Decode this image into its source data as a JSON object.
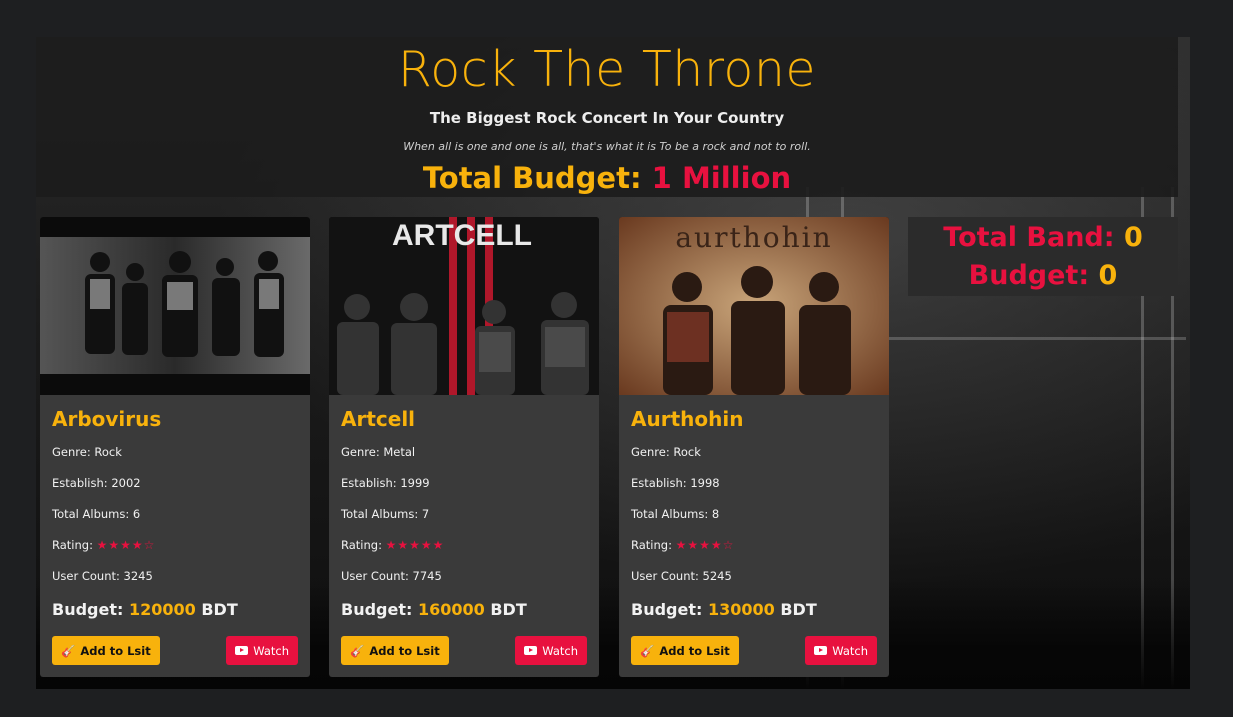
{
  "header": {
    "title": "Rock The Throne",
    "subtitle": "The Biggest Rock Concert In Your Country",
    "tagline": "When all is one and one is all, that's what it is To be a rock and not to roll.",
    "total_budget_label": "Total Budget:",
    "total_budget_value": "1 Million"
  },
  "summary": {
    "total_band_label": "Total Band:",
    "total_band_value": "0",
    "budget_label": "Budget:",
    "budget_value": "0"
  },
  "colors": {
    "accent": "#f8b20c",
    "danger": "#e8113f",
    "card": "#3a3a3a",
    "page": "#1e1f21"
  },
  "cards": [
    {
      "name": "Arbovirus",
      "genre": "Genre: Rock",
      "establish": "Establish: 2002",
      "albums": "Total Albums: 6",
      "rating_label": "Rating:",
      "rating_stars": "★★★★☆",
      "rating_value": 4,
      "user_count": "User Count: 3245",
      "budget_label": "Budget:",
      "budget_amount": "120000",
      "budget_unit": "BDT",
      "add_label": "Add to Lsit",
      "watch_label": "Watch"
    },
    {
      "name": "Artcell",
      "photo_text": "ARTCELL",
      "genre": "Genre: Metal",
      "establish": "Establish: 1999",
      "albums": "Total Albums: 7",
      "rating_label": "Rating:",
      "rating_stars": "★★★★★",
      "rating_value": 4.5,
      "user_count": "User Count: 7745",
      "budget_label": "Budget:",
      "budget_amount": "160000",
      "budget_unit": "BDT",
      "add_label": "Add to Lsit",
      "watch_label": "Watch"
    },
    {
      "name": "Aurthohin",
      "photo_text": "aurthohin",
      "genre": "Genre: Rock",
      "establish": "Establish: 1998",
      "albums": "Total Albums: 8",
      "rating_label": "Rating:",
      "rating_stars": "★★★★☆",
      "rating_value": 4.5,
      "user_count": "User Count: 5245",
      "budget_label": "Budget:",
      "budget_amount": "130000",
      "budget_unit": "BDT",
      "add_label": "Add to Lsit",
      "watch_label": "Watch"
    }
  ]
}
